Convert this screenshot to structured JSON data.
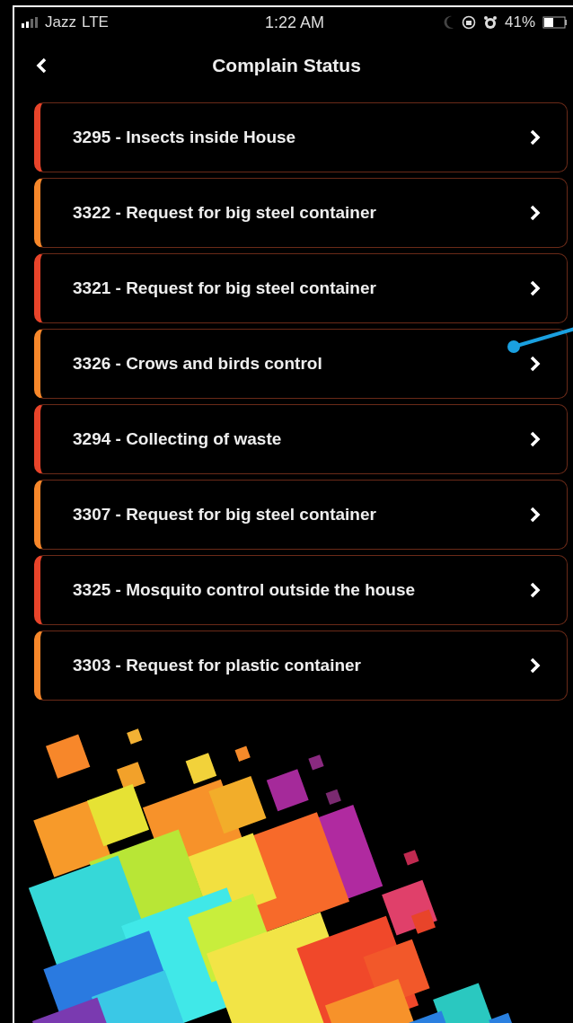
{
  "status_bar": {
    "carrier": "Jazz",
    "network": "LTE",
    "time": "1:22 AM",
    "battery": "41%"
  },
  "header": {
    "title": "Complain Status"
  },
  "complaints": [
    {
      "label": "3295 - Insects inside House",
      "color": "#e8442a"
    },
    {
      "label": "3322 - Request for big steel container",
      "color": "#f7872a"
    },
    {
      "label": "3321 - Request for big steel container",
      "color": "#e8442a"
    },
    {
      "label": "3326 - Crows and birds control",
      "color": "#f7872a"
    },
    {
      "label": "3294 - Collecting of waste",
      "color": "#e8442a"
    },
    {
      "label": "3307 - Request for big steel container",
      "color": "#f7872a"
    },
    {
      "label": "3325 - Mosquito control outside the house",
      "color": "#e8442a"
    },
    {
      "label": "3303 - Request for plastic container",
      "color": "#f7872a"
    }
  ]
}
